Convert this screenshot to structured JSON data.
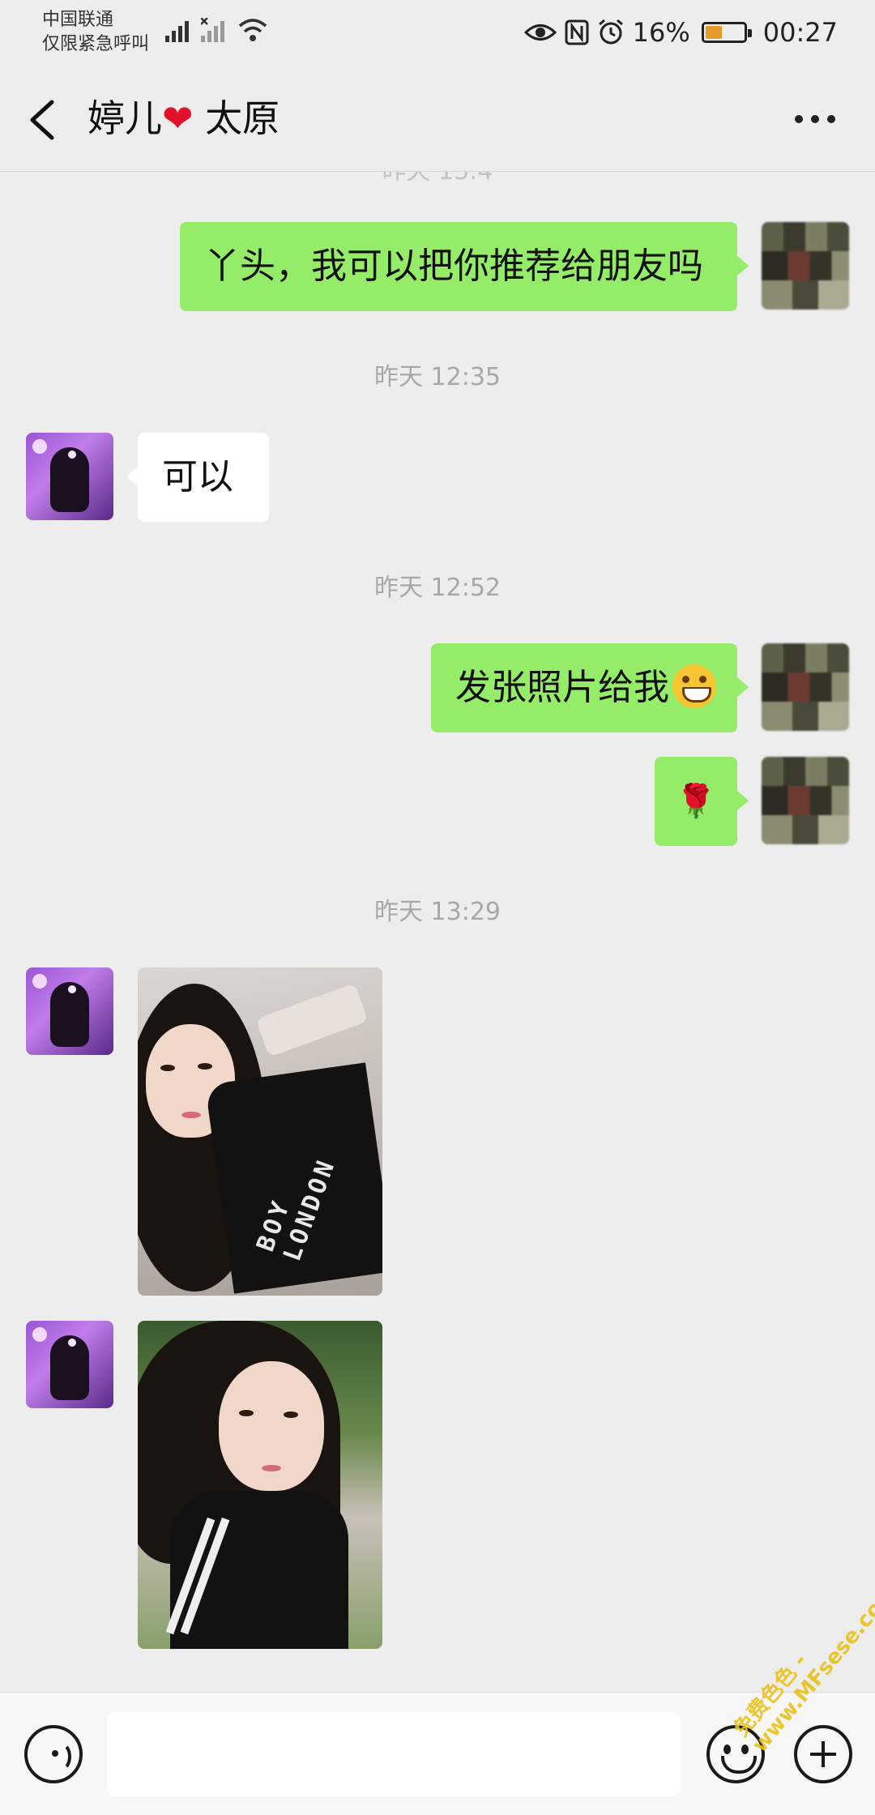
{
  "status_bar": {
    "carrier_line1": "中国联通",
    "carrier_line2": "仅限紧急呼叫",
    "battery_percent": "16%",
    "time": "00:27",
    "icons": [
      "signal-icon",
      "no-signal-icon",
      "wifi-icon",
      "eye-icon",
      "nfc-icon",
      "alarm-icon",
      "battery-icon"
    ]
  },
  "header": {
    "name_part1": "婷儿",
    "heart": "❤",
    "name_part2": "太原"
  },
  "chat": {
    "partial_timestamp": "昨天 13:4",
    "messages": [
      {
        "sender": "me",
        "type": "text",
        "text": "丫头，我可以把你推荐给朋友吗"
      },
      {
        "type": "timestamp",
        "text": "昨天 12:35"
      },
      {
        "sender": "her",
        "type": "text",
        "text": "可以"
      },
      {
        "type": "timestamp",
        "text": "昨天 12:52"
      },
      {
        "sender": "me",
        "type": "text",
        "text": "发张照片给我"
      },
      {
        "sender": "me",
        "type": "emoji",
        "text": "🌹"
      },
      {
        "type": "timestamp",
        "text": "昨天 13:29"
      },
      {
        "sender": "her",
        "type": "image",
        "print_text": "BOY LONDON"
      },
      {
        "sender": "her",
        "type": "image"
      }
    ]
  },
  "input_bar": {
    "placeholder": ""
  },
  "watermark": {
    "line1": "免费色色 -",
    "line2": "www.MFsese.com"
  },
  "colors": {
    "background": "#ededed",
    "my_bubble": "#95ec69",
    "her_bubble": "#ffffff",
    "timestamp": "#a8a8a8",
    "watermark": "#e9c21b"
  }
}
